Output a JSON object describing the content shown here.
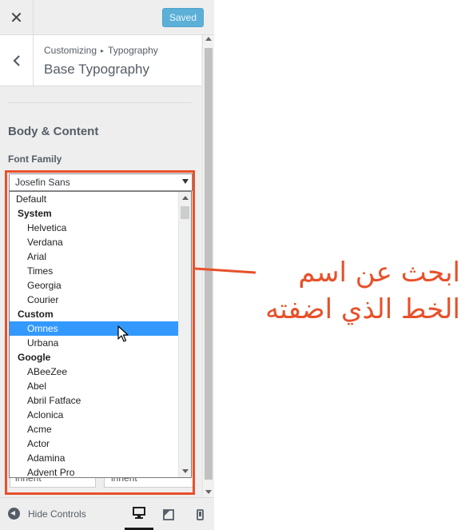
{
  "topbar": {
    "close_icon": "close-icon",
    "saved_label": "Saved",
    "accent_color": "#5cb0d8"
  },
  "section": {
    "breadcrumb_parent": "Customizing",
    "breadcrumb_separator": "▸",
    "breadcrumb_current": "Typography",
    "title": "Base Typography",
    "back_icon": "chevron-left-icon"
  },
  "content": {
    "group_title": "Body & Content",
    "font_family_label": "Font Family",
    "selected_font": "Josefin Sans",
    "dropdown_options": [
      {
        "label": "Default",
        "kind": "first"
      },
      {
        "label": "System",
        "kind": "group"
      },
      {
        "label": "Helvetica",
        "kind": "option"
      },
      {
        "label": "Verdana",
        "kind": "option"
      },
      {
        "label": "Arial",
        "kind": "option"
      },
      {
        "label": "Times",
        "kind": "option"
      },
      {
        "label": "Georgia",
        "kind": "option"
      },
      {
        "label": "Courier",
        "kind": "option"
      },
      {
        "label": "Custom",
        "kind": "group"
      },
      {
        "label": "Omnes",
        "kind": "option",
        "highlighted": true
      },
      {
        "label": "Urbana",
        "kind": "option"
      },
      {
        "label": "Google",
        "kind": "group"
      },
      {
        "label": "ABeeZee",
        "kind": "option"
      },
      {
        "label": "Abel",
        "kind": "option"
      },
      {
        "label": "Abril Fatface",
        "kind": "option"
      },
      {
        "label": "Aclonica",
        "kind": "option"
      },
      {
        "label": "Acme",
        "kind": "option"
      },
      {
        "label": "Actor",
        "kind": "option"
      },
      {
        "label": "Adamina",
        "kind": "option"
      },
      {
        "label": "Advent Pro",
        "kind": "option"
      }
    ],
    "partial_field_1": "inherit",
    "partial_field_2": "inherit"
  },
  "bottombar": {
    "hide_controls_label": "Hide Controls",
    "devices": [
      "desktop-icon",
      "tablet-icon",
      "mobile-icon"
    ],
    "active_device": "desktop-icon"
  },
  "annotation": {
    "line1": "ابحث عن اسم",
    "line2": "الخط الذي اضفته",
    "color": "#e8502a"
  }
}
